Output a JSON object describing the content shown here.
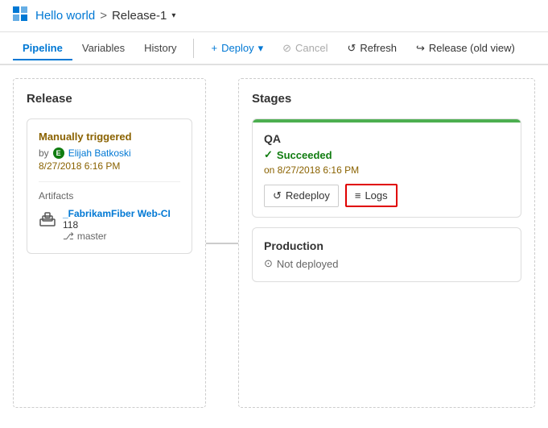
{
  "app": {
    "icon": "⬛",
    "breadcrumb": {
      "parent": "Hello world",
      "separator": ">",
      "current": "Release-1",
      "dropdown_arrow": "▾"
    }
  },
  "toolbar": {
    "tabs": [
      {
        "label": "Pipeline",
        "active": true
      },
      {
        "label": "Variables",
        "active": false
      },
      {
        "label": "History",
        "active": false
      }
    ],
    "actions": [
      {
        "icon": "+",
        "label": "Deploy",
        "type": "deploy",
        "has_arrow": true
      },
      {
        "icon": "⊘",
        "label": "Cancel",
        "type": "cancel"
      },
      {
        "icon": "↺",
        "label": "Refresh",
        "type": "refresh"
      },
      {
        "icon": "↪",
        "label": "Release (old view)",
        "type": "old-view"
      }
    ]
  },
  "release_panel": {
    "title": "Release",
    "card": {
      "triggered_label": "Manually triggered",
      "by_text": "by",
      "user_initial": "E",
      "user_name": "Elijah Batkoski",
      "timestamp": "8/27/2018 6:16 PM",
      "artifacts_label": "Artifacts",
      "artifact_icon": "🏛",
      "artifact_name": "_FabrikamFiber Web-CI",
      "artifact_build": "118",
      "branch_icon": "⎇",
      "artifact_branch": "master"
    }
  },
  "stages_panel": {
    "title": "Stages",
    "qa_stage": {
      "stage_name": "QA",
      "status": "Succeeded",
      "status_icon": "✓",
      "time_label": "on 8/27/2018 6:16 PM",
      "redeploy_label": "Redeploy",
      "redeploy_icon": "↺",
      "logs_label": "Logs",
      "logs_icon": "≡"
    },
    "prod_stage": {
      "stage_name": "Production",
      "status": "Not deployed",
      "status_icon": "⊙"
    }
  }
}
